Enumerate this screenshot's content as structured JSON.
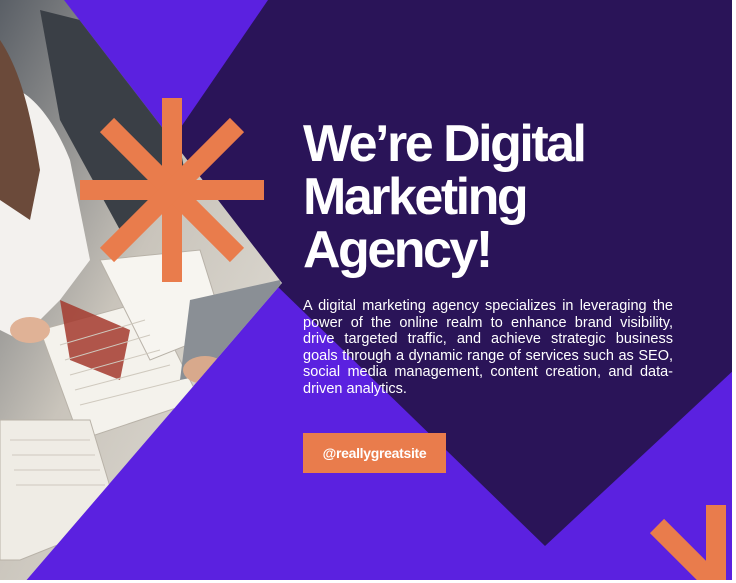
{
  "headline": {
    "line1": "We’re Digital",
    "line2": "Marketing",
    "line3": "Agency!"
  },
  "description": "A digital marketing agency specializes in leveraging the power of the online realm to enhance brand visibility, drive targeted traffic, and achieve strategic business goals through a dynamic range of services such as SEO, social media management, content creation, and data-driven analytics.",
  "cta": {
    "label": "@reallygreatsite"
  },
  "colors": {
    "violet": "#5b21e0",
    "dark_purple": "#2a1458",
    "orange": "#e97c4c",
    "white": "#ffffff"
  },
  "icons": [
    "asterisk-burst-icon",
    "corner-chevron-icon"
  ]
}
